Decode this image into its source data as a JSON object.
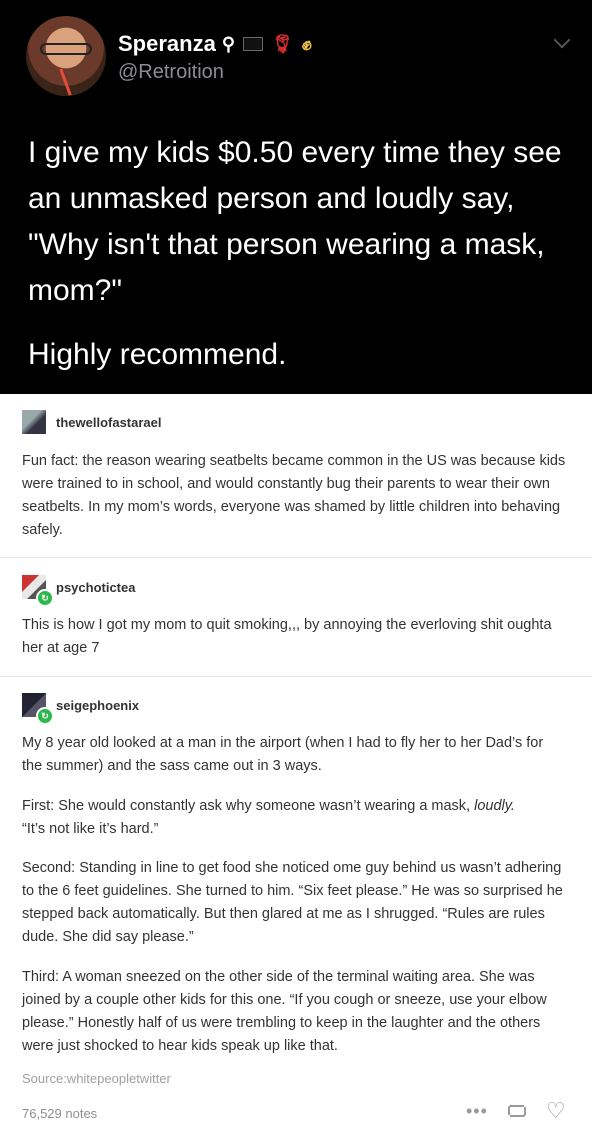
{
  "tweet": {
    "display_name": "Speranza",
    "name_emoji": [
      "woman-icon",
      "black-flag-icon",
      "rose-icon",
      "raised-fist-icon"
    ],
    "handle": "@Retroition",
    "body": "I give my kids $0.50 every time they see an unmasked person and loudly say, \"Why isn't that person wearing a mask, mom?\"",
    "closing": "Highly recommend."
  },
  "posts": [
    {
      "username": "thewellofastarael",
      "text": "Fun fact: the reason wearing seatbelts became common in the US was because kids were trained to in school, and would constantly bug their parents to wear their own seatbelts. In my mom’s words, everyone was shamed by little children into behaving safely."
    },
    {
      "username": "psychotictea",
      "text": "This is how I got my mom to quit smoking,,, by annoying the everloving shit oughta her at age 7"
    },
    {
      "username": "seigephoenix",
      "paragraphs": [
        "My 8 year old looked at a man in the airport (when I had to fly her to her Dad’s for the summer) and the sass came out in 3 ways.",
        "First: She would constantly ask why someone wasn’t wearing a mask, ",
        "“It’s not like it’s hard.”",
        "Second: Standing in line to get food she noticed ome guy behind us wasn’t adhering to the 6 feet guidelines. She turned to him. “Six feet please.” He was so surprised he stepped back automatically. But then glared at me as I shrugged. “Rules are rules dude. She did say please.”",
        "Third: A woman sneezed on the other side of the terminal waiting area. She was joined by a couple other kids for this one. “If you cough or sneeze, use your elbow please.” Honestly half of us were trembling to keep in the laughter and the others were just shocked to hear kids speak up like that."
      ],
      "emphasis": "loudly."
    }
  ],
  "source": "Source:whitepeopletwitter",
  "notes": "76,529 notes",
  "colors": {
    "tweet_bg": "#000000",
    "badge_green": "#2db84d",
    "text": "#333333",
    "muted": "#a0a0a0"
  }
}
